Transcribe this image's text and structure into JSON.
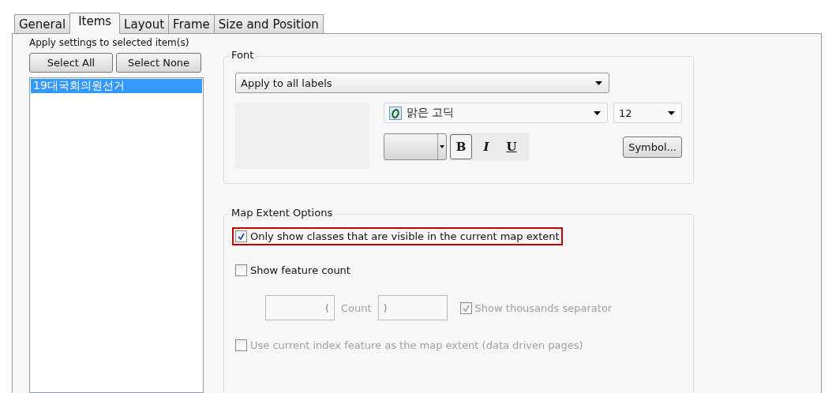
{
  "tabs": [
    {
      "label": "General",
      "selected": false
    },
    {
      "label": "Items",
      "selected": true
    },
    {
      "label": "Layout",
      "selected": false
    },
    {
      "label": "Frame",
      "selected": false
    },
    {
      "label": "Size and Position",
      "selected": false
    }
  ],
  "apply_label": "Apply settings to selected item(s)",
  "select_buttons": [
    "Select All",
    "Select None"
  ],
  "items": [
    {
      "label": "19대국회의원선거",
      "selected": true
    }
  ],
  "font": {
    "title": "Font",
    "apply_dropdown": "Apply to all labels",
    "font_name": "맑은 고딕",
    "font_size": "12",
    "styles": [
      {
        "label": "B",
        "kind": "bold",
        "selected": true
      },
      {
        "label": "I",
        "kind": "italic",
        "selected": false
      },
      {
        "label": "U",
        "kind": "underline",
        "selected": false
      }
    ],
    "symbol_button": "Symbol..."
  },
  "map_extent": {
    "title": "Map Extent Options",
    "only_visible": {
      "label": "Only show classes that are visible in the current map extent",
      "checked": true,
      "highlighted": true
    },
    "feature_count": {
      "label": "Show feature count",
      "checked": false
    },
    "prefix": "(",
    "count_label": "Count",
    "suffix": ")",
    "thousands": {
      "label": "Show thousands separator",
      "checked": true,
      "disabled": true
    },
    "index_feature": {
      "label": "Use current index feature as the map extent (data driven pages)",
      "checked": false,
      "disabled": true
    }
  }
}
